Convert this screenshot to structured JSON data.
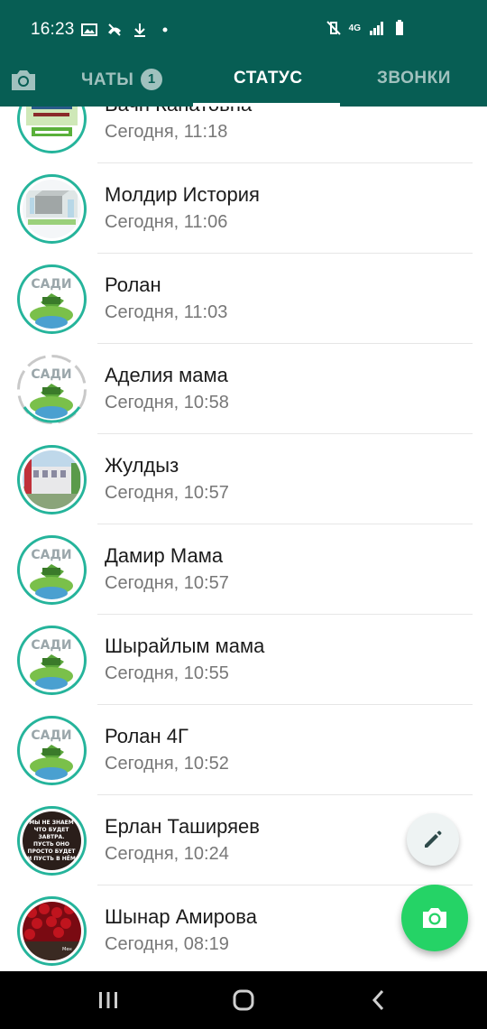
{
  "status_bar": {
    "time": "16:23",
    "network_label": "4G"
  },
  "tabs": {
    "chats": "ЧАТЫ",
    "chats_badge": "1",
    "status": "СТАТУС",
    "calls": "ЗВОНКИ"
  },
  "colors": {
    "brand": "#075e54",
    "accent": "#25d366",
    "ring_viewed": "#25b49b",
    "ring_muted": "#c9c9c9"
  },
  "status_list": [
    {
      "name": "Вачн Канатовна",
      "time": "Сегодня, 11:18",
      "ring": "solid",
      "avatar": "green-banner"
    },
    {
      "name": "Молдир История",
      "time": "Сегодня, 11:06",
      "ring": "solid",
      "avatar": "gray-box"
    },
    {
      "name": "Ролан",
      "time": "Сегодня, 11:03",
      "ring": "solid",
      "avatar": "sadi-logo"
    },
    {
      "name": "Аделия мама",
      "time": "Сегодня, 10:58",
      "ring": "segmented",
      "avatar": "sadi-logo"
    },
    {
      "name": "Жулдыз",
      "time": "Сегодня, 10:57",
      "ring": "solid",
      "avatar": "building"
    },
    {
      "name": "Дамир Мама",
      "time": "Сегодня, 10:57",
      "ring": "solid",
      "avatar": "sadi-logo"
    },
    {
      "name": "Шырайлым мама",
      "time": "Сегодня, 10:55",
      "ring": "solid",
      "avatar": "sadi-logo"
    },
    {
      "name": "Ролан 4Г",
      "time": "Сегодня, 10:52",
      "ring": "solid",
      "avatar": "sadi-logo"
    },
    {
      "name": "Ерлан Таширяев",
      "time": "Сегодня, 10:24",
      "ring": "solid",
      "avatar": "dark-text"
    },
    {
      "name": "Шынар Амирова",
      "time": "Сегодня, 08:19",
      "ring": "solid",
      "avatar": "roses"
    }
  ]
}
